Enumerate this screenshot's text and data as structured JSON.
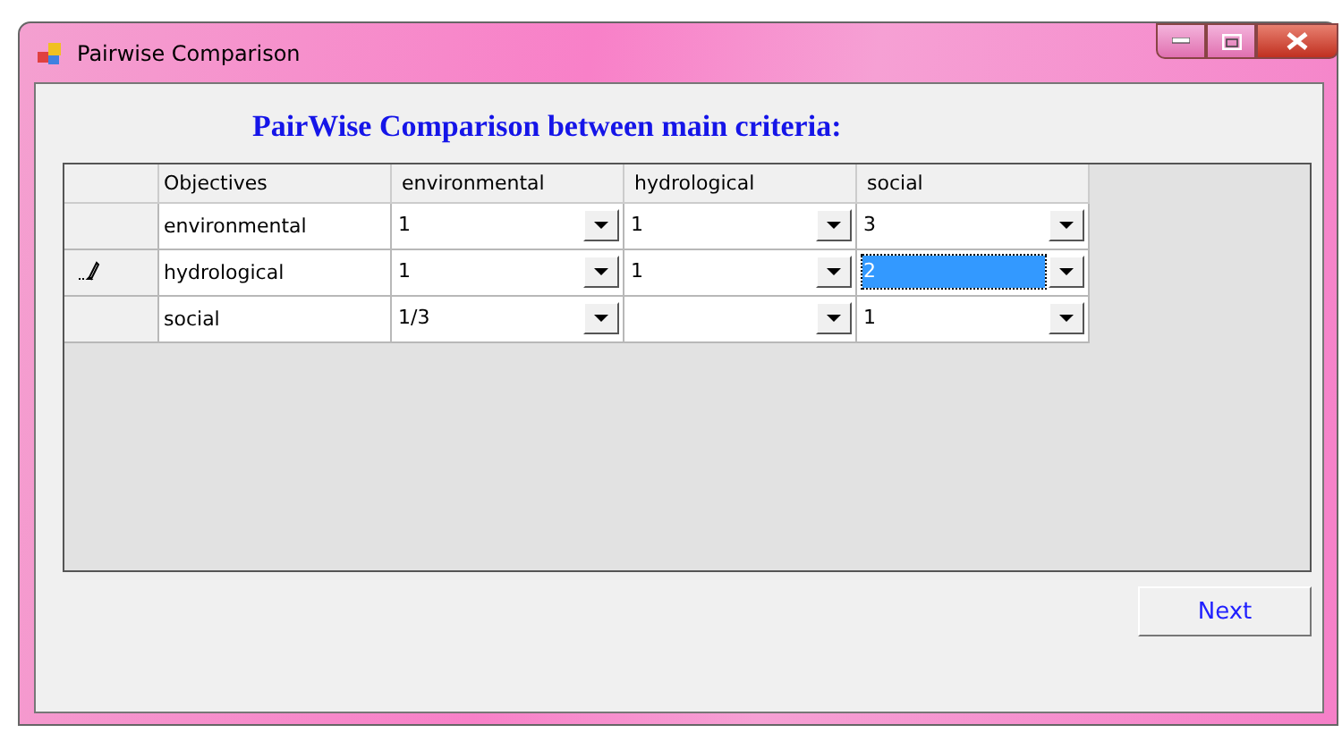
{
  "window": {
    "title": "Pairwise Comparison"
  },
  "heading": "PairWise Comparison between main criteria:",
  "table": {
    "columns": [
      "Objectives",
      "environmental",
      "hydrological",
      "social"
    ],
    "rows": [
      {
        "editing": false,
        "cells": [
          {
            "kind": "text",
            "value": "environmental"
          },
          {
            "kind": "dropdown",
            "value": "1",
            "selected": false
          },
          {
            "kind": "dropdown",
            "value": "1",
            "selected": false
          },
          {
            "kind": "dropdown",
            "value": "3",
            "selected": false
          }
        ]
      },
      {
        "editing": true,
        "cells": [
          {
            "kind": "text",
            "value": "hydrological"
          },
          {
            "kind": "dropdown",
            "value": "1",
            "selected": false
          },
          {
            "kind": "dropdown",
            "value": "1",
            "selected": false
          },
          {
            "kind": "dropdown",
            "value": "2",
            "selected": true
          }
        ]
      },
      {
        "editing": false,
        "cells": [
          {
            "kind": "text",
            "value": "social"
          },
          {
            "kind": "dropdown",
            "value": "1/3",
            "selected": false
          },
          {
            "kind": "dropdown",
            "selected": false
          },
          {
            "kind": "dropdown",
            "value": "1",
            "selected": false
          }
        ]
      }
    ]
  },
  "buttons": [
    "Next"
  ]
}
